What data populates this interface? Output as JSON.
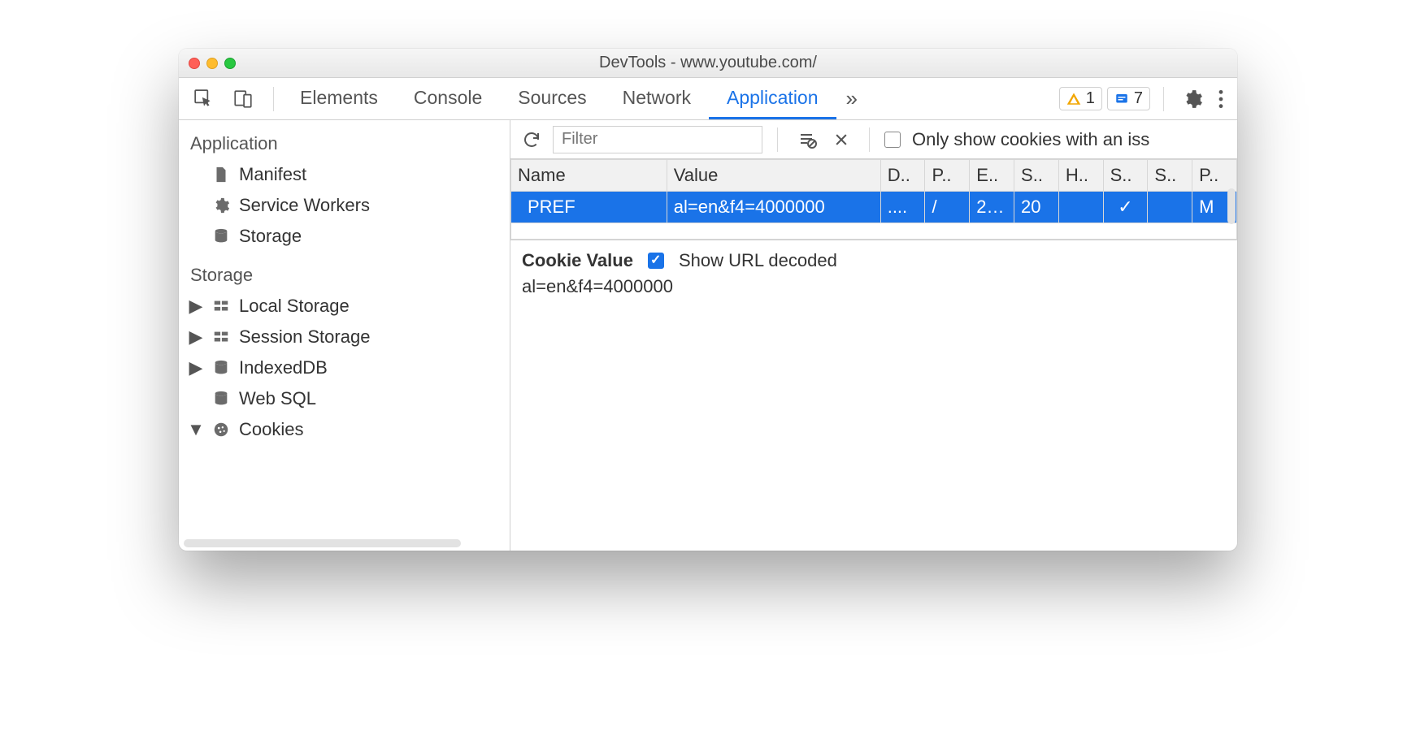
{
  "window": {
    "title": "DevTools - www.youtube.com/"
  },
  "tabs": {
    "items": [
      "Elements",
      "Console",
      "Sources",
      "Network",
      "Application"
    ],
    "active": "Application",
    "overflow": "»"
  },
  "warnings": {
    "count": "1"
  },
  "messages": {
    "count": "7"
  },
  "sidebar": {
    "group_application": "Application",
    "app_items": {
      "manifest": "Manifest",
      "service_workers": "Service Workers",
      "storage": "Storage"
    },
    "group_storage": "Storage",
    "storage_items": {
      "local_storage": "Local Storage",
      "session_storage": "Session Storage",
      "indexeddb": "IndexedDB",
      "web_sql": "Web SQL",
      "cookies": "Cookies"
    }
  },
  "subtoolbar": {
    "filter_placeholder": "Filter",
    "only_issues_label": "Only show cookies with an iss"
  },
  "table": {
    "headers": [
      "Name",
      "Value",
      "D..",
      "P..",
      "E..",
      "S..",
      "H..",
      "S..",
      "S..",
      "P.."
    ],
    "row": {
      "name": "PREF",
      "value": "al=en&f4=4000000",
      "domain": "....",
      "path": "/",
      "expires": "2…",
      "size": "20",
      "httponly": "",
      "secure": "✓",
      "samesite": "",
      "priority": "M"
    }
  },
  "details": {
    "cookie_value_label": "Cookie Value",
    "show_decoded_label": "Show URL decoded",
    "show_decoded_checked": true,
    "value": "al=en&f4=4000000"
  }
}
